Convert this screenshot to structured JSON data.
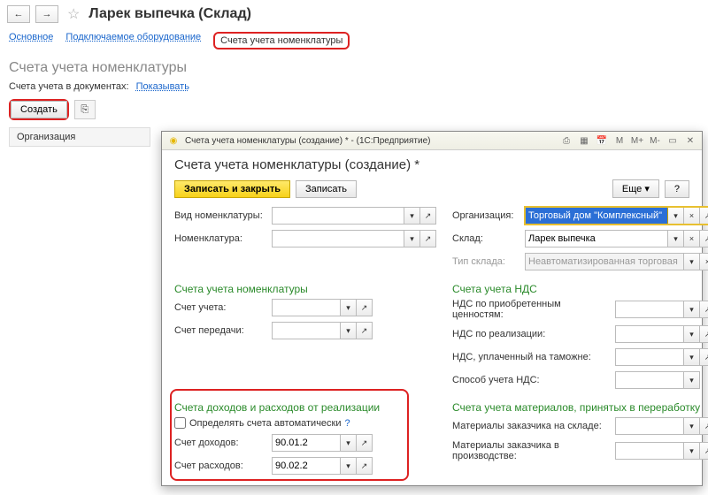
{
  "header": {
    "title": "Ларек выпечка (Склад)",
    "tabs": [
      "Основное",
      "Подключаемое оборудование",
      "Счета учета номенклатуры"
    ],
    "subTitle": "Счета учета номенклатуры",
    "docsLabel": "Счета учета в документах:",
    "showLink": "Показывать",
    "createBtn": "Создать",
    "colOrg": "Организация"
  },
  "dialog": {
    "winTitle": "Счета учета номенклатуры (создание) * - (1С:Предприятие)",
    "heading": "Счета учета номенклатуры (создание) *",
    "saveClose": "Записать и закрыть",
    "save": "Записать",
    "more": "Еще",
    "help": "?",
    "fields": {
      "vidNom": "Вид номенклатуры:",
      "org": "Организация:",
      "orgVal": "Торговый дом \"Комплексный\" ООО",
      "nom": "Номенклатура:",
      "sklad": "Склад:",
      "skladVal": "Ларек выпечка",
      "tipSklada": "Тип склада:",
      "tipSkladaVal": "Неавтоматизированная торговая точка"
    },
    "sec1": {
      "title": "Счета учета номенклатуры",
      "acc": "Счет учета:",
      "transfer": "Счет передачи:"
    },
    "sec2": {
      "title": "Счета учета НДС",
      "ndsPriob": "НДС по приобретенным ценностям:",
      "ndsReal": "НДС по реализации:",
      "ndsCust": "НДС, уплаченный на таможне:",
      "ndsMethod": "Способ учета НДС:"
    },
    "sec3": {
      "title": "Счета доходов и расходов от реализации",
      "autoChk": "Определять счета автоматически",
      "income": "Счет доходов:",
      "incomeVal": "90.01.2",
      "expense": "Счет расходов:",
      "expenseVal": "90.02.2"
    },
    "sec4": {
      "title": "Счета учета материалов, принятых в переработку",
      "m1": "Материалы заказчика на складе:",
      "m2": "Материалы заказчика в производстве:"
    }
  }
}
